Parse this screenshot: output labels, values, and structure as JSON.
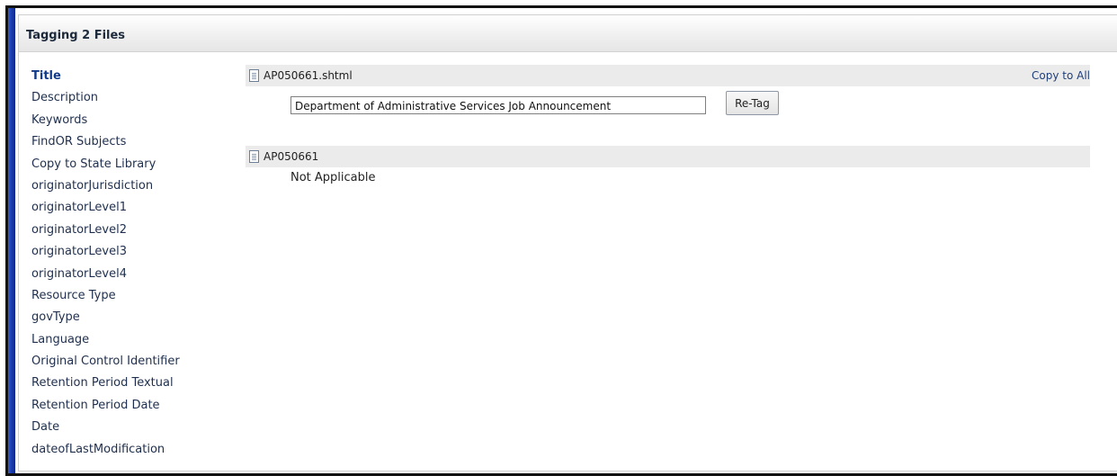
{
  "panel": {
    "title": "Tagging 2 Files"
  },
  "fields": [
    {
      "label": "Title",
      "active": true
    },
    {
      "label": "Description"
    },
    {
      "label": "Keywords"
    },
    {
      "label": "FindOR Subjects"
    },
    {
      "label": "Copy to State Library"
    },
    {
      "label": "originatorJurisdiction"
    },
    {
      "label": "originatorLevel1"
    },
    {
      "label": "originatorLevel2"
    },
    {
      "label": "originatorLevel3"
    },
    {
      "label": "originatorLevel4"
    },
    {
      "label": "Resource Type"
    },
    {
      "label": "govType"
    },
    {
      "label": "Language"
    },
    {
      "label": "Original Control Identifier"
    },
    {
      "label": "Retention Period Textual"
    },
    {
      "label": "Retention Period Date"
    },
    {
      "label": "Date"
    },
    {
      "label": "dateofLastModification"
    }
  ],
  "files": [
    {
      "name": "AP050661.shtml",
      "copy_to_all_label": "Copy to All",
      "title_value": "Department of Administrative Services Job Announcement",
      "retag_label": "Re-Tag"
    },
    {
      "name": "AP050661",
      "status_text": "Not Applicable"
    }
  ],
  "icons": {
    "file": "document-icon"
  }
}
